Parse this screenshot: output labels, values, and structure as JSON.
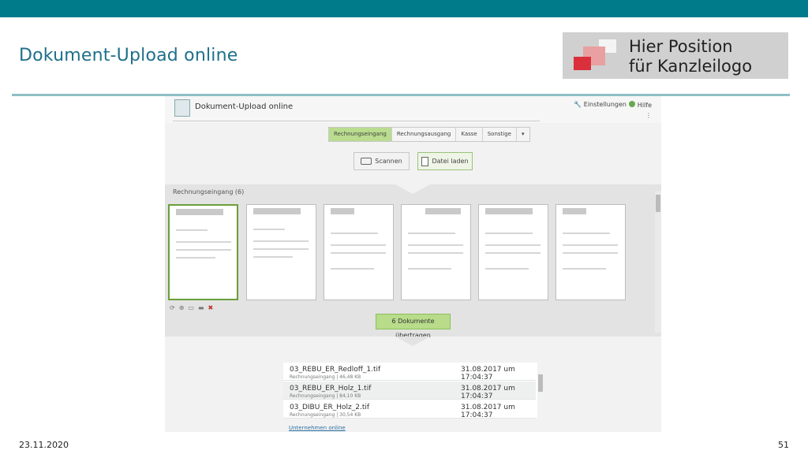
{
  "slide": {
    "title": "Dokument-Upload online",
    "logo_line1": "Hier Position",
    "logo_line2": "für Kanzleilogo",
    "date": "23.11.2020",
    "page": "51",
    "colors": {
      "topbar": "#007b8a",
      "title": "#1f6f8b",
      "rule": "#8fc0c6",
      "logo_red": "#d9303c",
      "logo_pink": "#e9a0a0"
    }
  },
  "app": {
    "title": "Dokument-Upload online",
    "settings_label": "Einstellungen",
    "help_label": "Hilfe",
    "tabs": [
      {
        "label": "Rechnungseingang",
        "active": true
      },
      {
        "label": "Rechnungsausgang",
        "active": false
      },
      {
        "label": "Kasse",
        "active": false
      },
      {
        "label": "Sonstige",
        "active": false
      }
    ],
    "tab_more": "▾",
    "scan_label": "Scannen",
    "file_label": "Datei laden",
    "section_label": "Rechnungseingang (6)",
    "upload_label": "6 Dokumente übertragen",
    "files": [
      {
        "name": "03_REBU_ER_Redloff_1.tif",
        "meta": "Rechnungseingang | 46,48 KB",
        "date": "31.08.2017 um 17:04:37"
      },
      {
        "name": "03_REBU_ER_Holz_1.tif",
        "meta": "Rechnungseingang | 84,10 KB",
        "date": "31.08.2017 um 17:04:37"
      },
      {
        "name": "03_DIBU_ER_Holz_2.tif",
        "meta": "Rechnungseingang | 30,54 KB",
        "date": "31.08.2017 um 17:04:37"
      }
    ],
    "footer_link": "Unternehmen online"
  }
}
